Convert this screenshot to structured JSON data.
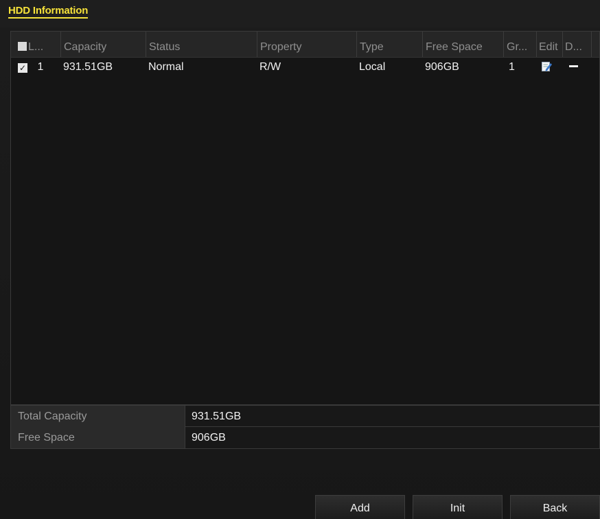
{
  "title_tab": "HDD Information",
  "table": {
    "headers": {
      "label": "L...",
      "capacity": "Capacity",
      "status": "Status",
      "property": "Property",
      "type": "Type",
      "free_space": "Free Space",
      "group": "Gr...",
      "edit": "Edit",
      "delete": "D..."
    },
    "rows": [
      {
        "checked": true,
        "label": "1",
        "capacity": "931.51GB",
        "status": "Normal",
        "property": "R/W",
        "type": "Local",
        "free_space": "906GB",
        "group": "1",
        "edit_icon": "edit-icon",
        "delete_icon": "dash-icon"
      }
    ]
  },
  "summary": {
    "total_capacity_label": "Total Capacity",
    "total_capacity_value": "931.51GB",
    "free_space_label": "Free Space",
    "free_space_value": "906GB"
  },
  "buttons": {
    "add": "Add",
    "init": "Init",
    "back": "Back"
  },
  "colors": {
    "title_accent": "#f6e23a",
    "background": "#171717"
  }
}
